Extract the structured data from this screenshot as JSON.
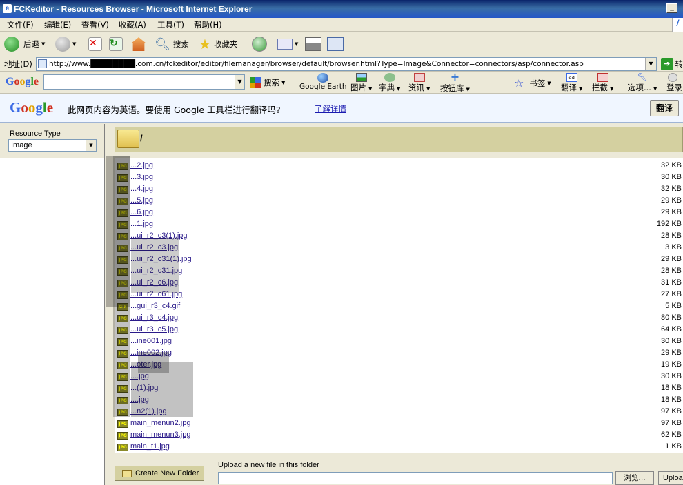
{
  "window": {
    "title": "FCKeditor - Resources Browser - Microsoft Internet Explorer",
    "minimize": "_"
  },
  "menu": [
    "文件(F)",
    "编辑(E)",
    "查看(V)",
    "收藏(A)",
    "工具(T)",
    "帮助(H)"
  ],
  "toolbar": {
    "back": "后退",
    "search": "搜索",
    "favorites": "收藏夹"
  },
  "address": {
    "label": "地址(D)",
    "url": "http://www.████████.com.cn/fckeditor/editor/filemanager/browser/default/browser.html?Type=Image&Connector=connectors/asp/connector.asp",
    "go_label": "转"
  },
  "google_toolbar": {
    "logo": "Google",
    "search_label": "搜索",
    "earth": "Google Earth",
    "images": "图片",
    "dictionary": "字典",
    "news": "资讯",
    "buttons": "按钮库",
    "bookmarks": "书签",
    "translate": "翻译",
    "block": "拦截",
    "options": "选项...",
    "login": "登录"
  },
  "translate_bar": {
    "logo": "Google",
    "message": "此网页内容为英语。要使用 Google 工具栏进行翻译吗?",
    "learn_more": "了解详情",
    "button": "翻译"
  },
  "resource_type": {
    "label": "Resource Type",
    "value": "Image"
  },
  "folder": {
    "path": "/"
  },
  "files": [
    {
      "name": "...2.jpg",
      "size": "32 KB",
      "type": "JPG"
    },
    {
      "name": "...3.jpg",
      "size": "30 KB",
      "type": "JPG"
    },
    {
      "name": "...4.jpg",
      "size": "32 KB",
      "type": "JPG"
    },
    {
      "name": "...5.jpg",
      "size": "29 KB",
      "type": "JPG"
    },
    {
      "name": "...6.jpg",
      "size": "29 KB",
      "type": "JPG"
    },
    {
      "name": "...1.jpg",
      "size": "192 KB",
      "type": "JPG"
    },
    {
      "name": "...ui_r2_c3(1).jpg",
      "size": "28 KB",
      "type": "JPG"
    },
    {
      "name": "...ui_r2_c3.jpg",
      "size": "3 KB",
      "type": "JPG"
    },
    {
      "name": "...ui_r2_c31(1).jpg",
      "size": "29 KB",
      "type": "JPG"
    },
    {
      "name": "...ui_r2_c31.jpg",
      "size": "28 KB",
      "type": "JPG"
    },
    {
      "name": "...ui_r2_c6.jpg",
      "size": "31 KB",
      "type": "JPG"
    },
    {
      "name": "...ui_r2_c61.jpg",
      "size": "27 KB",
      "type": "JPG"
    },
    {
      "name": "...gui_r3_c4.gif",
      "size": "5 KB",
      "type": "GIF"
    },
    {
      "name": "...ui_r3_c4.jpg",
      "size": "80 KB",
      "type": "JPG"
    },
    {
      "name": "...ui_r3_c5.jpg",
      "size": "64 KB",
      "type": "JPG"
    },
    {
      "name": "...ine001.jpg",
      "size": "30 KB",
      "type": "JPG"
    },
    {
      "name": "...ine002.jpg",
      "size": "29 KB",
      "type": "JPG"
    },
    {
      "name": "...oter.jpg",
      "size": "19 KB",
      "type": "JPG"
    },
    {
      "name": "....jpg",
      "size": "30 KB",
      "type": "JPG"
    },
    {
      "name": "...(1).jpg",
      "size": "18 KB",
      "type": "JPG"
    },
    {
      "name": "....jpg",
      "size": "18 KB",
      "type": "JPG"
    },
    {
      "name": "...n2(1).jpg",
      "size": "97 KB",
      "type": "JPG"
    },
    {
      "name": "main_menun2.jpg",
      "size": "97 KB",
      "type": "JPG"
    },
    {
      "name": "main_menun3.jpg",
      "size": "62 KB",
      "type": "JPG"
    },
    {
      "name": "main_t1.jpg",
      "size": "1 KB",
      "type": "JPG"
    }
  ],
  "bottom": {
    "create_folder": "Create New Folder",
    "upload_label": "Upload a new file in this folder",
    "browse": "浏览...",
    "upload": "Upload"
  },
  "colors": {
    "title_bar": "#0a246a",
    "link": "#2a1a8a",
    "folder_header": "#d4d0a0"
  }
}
